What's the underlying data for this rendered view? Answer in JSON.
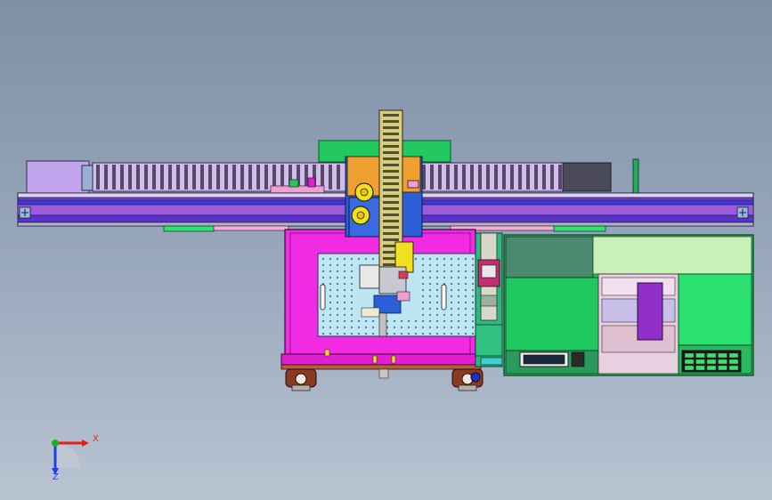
{
  "viewport": {
    "background_top": "#7f8fa6",
    "background_bottom": "#b9c4d2"
  },
  "triad": {
    "x_label": "X",
    "z_label": "Z",
    "x_color": "#e02020",
    "y_color": "#20b020",
    "z_color": "#2040e0"
  },
  "colors": {
    "rail_purple": "#8a4fd8",
    "rail_blue": "#3a3ad8",
    "chain_lavender": "#c4a8e8",
    "carriage_orange": "#f0a030",
    "carriage_blue": "#2c5fd6",
    "table_magenta": "#f020e0",
    "table_light_blue": "#b8e4f4",
    "cabinet_green": "#1ec85a",
    "cabinet_light_green": "#c8f0b8",
    "accent_yellow": "#f0e020",
    "wheel_brown": "#8a3a20"
  }
}
